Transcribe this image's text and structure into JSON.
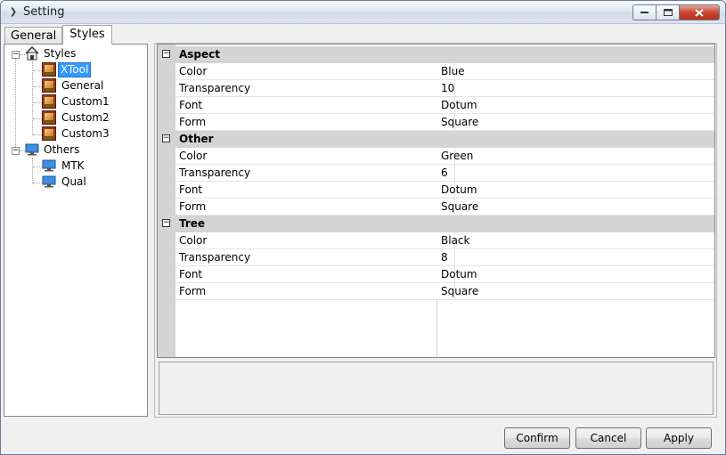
{
  "window": {
    "title": "Setting"
  },
  "tabs": [
    {
      "label": "General",
      "active": false
    },
    {
      "label": "Styles",
      "active": true
    }
  ],
  "tree": {
    "root1": {
      "label": "Styles",
      "children": [
        "XTool",
        "General",
        "Custom1",
        "Custom2",
        "Custom3"
      ],
      "selected": "XTool"
    },
    "root2": {
      "label": "Others",
      "children": [
        "MTK",
        "Qual"
      ]
    }
  },
  "grid": {
    "categories": [
      {
        "name": "Aspect",
        "rows": [
          {
            "key": "Color",
            "value": "Blue"
          },
          {
            "key": "Transparency",
            "value": "10"
          },
          {
            "key": "Font",
            "value": "Dotum"
          },
          {
            "key": "Form",
            "value": "Square"
          }
        ]
      },
      {
        "name": "Other",
        "rows": [
          {
            "key": "Color",
            "value": "Green"
          },
          {
            "key": "Transparency",
            "value": "6"
          },
          {
            "key": "Font",
            "value": "Dotum"
          },
          {
            "key": "Form",
            "value": "Square"
          }
        ]
      },
      {
        "name": "Tree",
        "rows": [
          {
            "key": "Color",
            "value": "Black"
          },
          {
            "key": "Transparency",
            "value": "8"
          },
          {
            "key": "Font",
            "value": "Dotum"
          },
          {
            "key": "Form",
            "value": "Square"
          }
        ]
      }
    ],
    "collapse_symbol": "⊟"
  },
  "buttons": {
    "confirm": "Confirm",
    "cancel": "Cancel",
    "apply": "Apply"
  }
}
